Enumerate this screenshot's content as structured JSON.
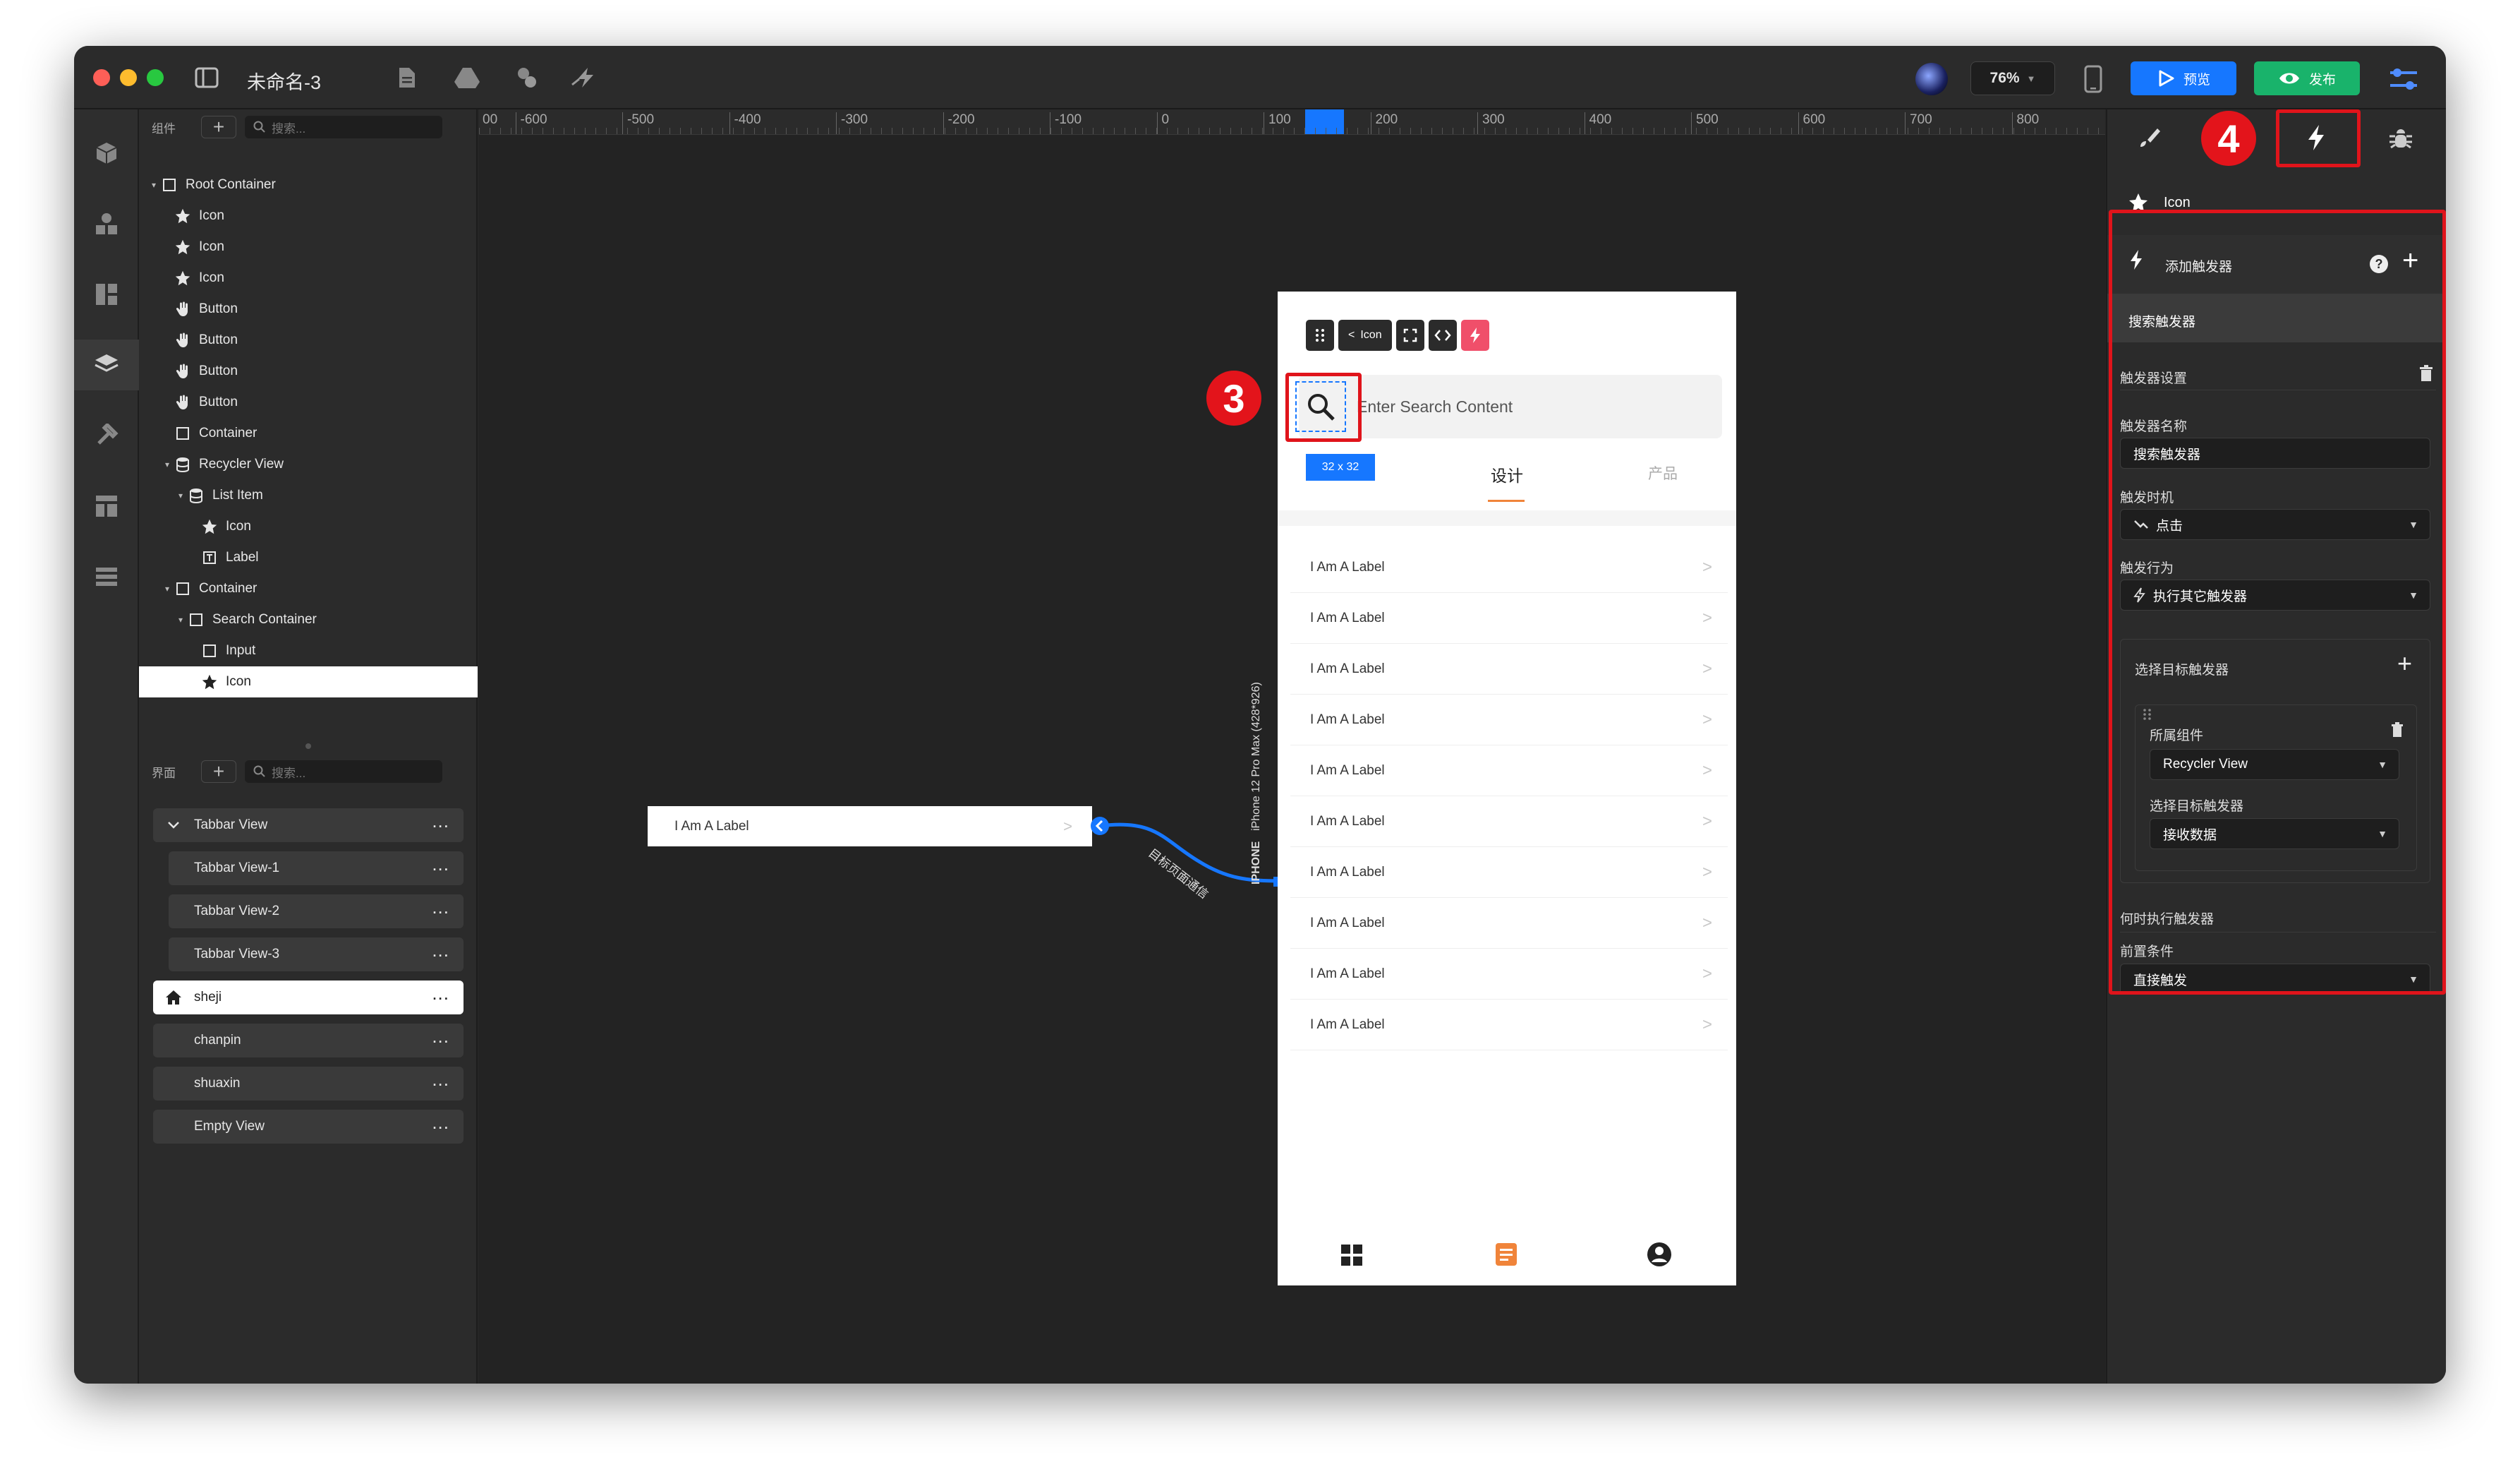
{
  "window": {
    "title": "未命名-3",
    "zoom": "76%",
    "preview_label": "预览",
    "publish_label": "发布"
  },
  "left_panel": {
    "components_label": "组件",
    "search_placeholder": "搜索...",
    "tree": [
      {
        "label": "Root Container",
        "icon": "square-icon",
        "arrow": "▾"
      },
      {
        "label": "Icon",
        "icon": "star-icon"
      },
      {
        "label": "Icon",
        "icon": "star-icon"
      },
      {
        "label": "Icon",
        "icon": "star-icon"
      },
      {
        "label": "Button",
        "icon": "hand-icon"
      },
      {
        "label": "Button",
        "icon": "hand-icon"
      },
      {
        "label": "Button",
        "icon": "hand-icon"
      },
      {
        "label": "Button",
        "icon": "hand-icon"
      },
      {
        "label": "Container",
        "icon": "square-icon"
      },
      {
        "label": "Recycler View",
        "icon": "database-icon",
        "arrow": "▾"
      },
      {
        "label": "List Item",
        "icon": "database-icon",
        "arrow": "▾"
      },
      {
        "label": "Icon",
        "icon": "star-icon"
      },
      {
        "label": "Label",
        "icon": "text-box-icon"
      },
      {
        "label": "Container",
        "icon": "square-icon",
        "arrow": "▾"
      },
      {
        "label": "Search Container",
        "icon": "square-icon",
        "arrow": "▾"
      },
      {
        "label": "Input",
        "icon": "square-icon"
      },
      {
        "label": "Icon",
        "icon": "star-icon"
      }
    ],
    "pages_label": "界面",
    "pages": [
      {
        "label": "Tabbar View"
      },
      {
        "label": "Tabbar View-1"
      },
      {
        "label": "Tabbar View-2"
      },
      {
        "label": "Tabbar View-3"
      },
      {
        "label": "sheji"
      },
      {
        "label": "chanpin"
      },
      {
        "label": "shuaxin"
      },
      {
        "label": "Empty View"
      }
    ]
  },
  "ruler": {
    "ticks": [
      "00",
      "-600",
      "-500",
      "-400",
      "-300",
      "-200",
      "-100",
      "0",
      "100",
      "200",
      "300",
      "400",
      "500",
      "600",
      "700",
      "800"
    ]
  },
  "canvas": {
    "floating_item_label": "I Am A Label",
    "connector_label": "目标页面通信",
    "device_tag": "IPHONE",
    "device_name": "iPhone 12 Pro Max (428*926)",
    "phone": {
      "toolbar": {
        "icon_label": "Icon"
      },
      "search_placeholder": "Enter Search Content",
      "size_badge": "32 x 32",
      "tabs": [
        "设计",
        "产品"
      ],
      "list_items": [
        "I Am A Label",
        "I Am A Label",
        "I Am A Label",
        "I Am A Label",
        "I Am A Label",
        "I Am A Label",
        "I Am A Label",
        "I Am A Label",
        "I Am A Label",
        "I Am A Label"
      ]
    },
    "badge_3": "3",
    "badge_4": "4"
  },
  "right_panel": {
    "selected_name": "Icon",
    "add_trigger": "添加触发器",
    "search_trigger": "搜索触发器",
    "trigger_settings": "触发器设置",
    "trigger_name_label": "触发器名称",
    "trigger_name_value": "搜索触发器",
    "trigger_time_label": "触发时机",
    "trigger_time_value": "点击",
    "trigger_action_label": "触发行为",
    "trigger_action_value": "执行其它触发器",
    "select_target_label": "选择目标触发器",
    "owner_component_label": "所属组件",
    "owner_component_value": "Recycler View",
    "select_trigger_label": "选择目标触发器",
    "select_trigger_value": "接收数据",
    "when_label": "何时执行触发器",
    "precondition_label": "前置条件",
    "precondition_value": "直接触发"
  },
  "colors": {
    "accent_blue": "#1677ff",
    "publish_green": "#19b36b",
    "highlight_red": "#e0141b",
    "tab_orange": "#f0843a"
  }
}
